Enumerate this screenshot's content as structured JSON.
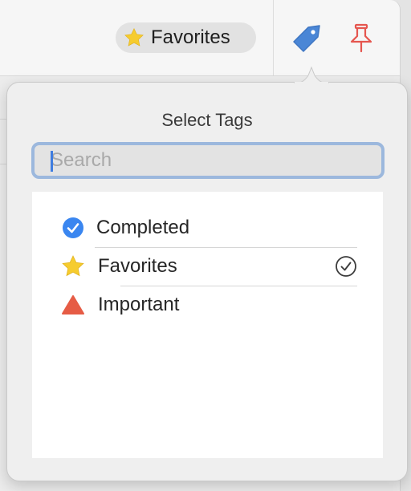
{
  "toolbar": {
    "favorites_chip_label": "Favorites"
  },
  "popover": {
    "title": "Select Tags",
    "search": {
      "placeholder": "Search",
      "value": ""
    },
    "tags": [
      {
        "label": "Completed",
        "icon": "blue-checkmark-circle-icon",
        "selected": false
      },
      {
        "label": "Favorites",
        "icon": "yellow-star-icon",
        "selected": true
      },
      {
        "label": "Important",
        "icon": "red-triangle-icon",
        "selected": false
      }
    ]
  },
  "colors": {
    "accent_blue": "#3a86f0",
    "star_yellow": "#f6cc2e",
    "important_red": "#e65c45",
    "pin_red": "#e5564f",
    "focus_ring": "#9cb8dd"
  }
}
